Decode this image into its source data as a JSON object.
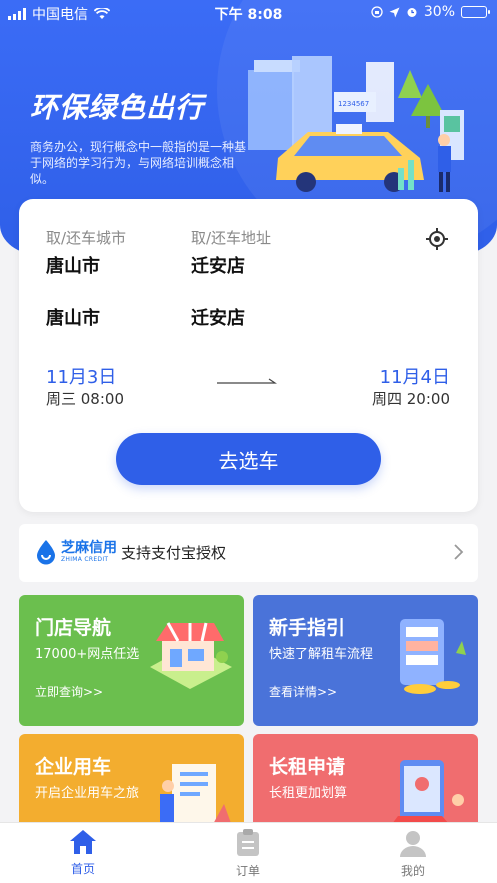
{
  "status_bar": {
    "carrier": "中国电信",
    "time": "下午 8:08",
    "battery": "30%",
    "battery_level": 0.3
  },
  "hero": {
    "slogan": "环保绿色出行",
    "description": "商务办公，现行概念中一般指的是一种基于网络的学习行为，与网络培训概念相似。",
    "illustration_icon": "city-taxi-illustration",
    "sign_text": "1234567"
  },
  "booking": {
    "pickup_city_label": "取/还车城市",
    "pickup_address_label": "取/还车地址",
    "pickup_city": "唐山市",
    "pickup_store": "迁安店",
    "return_city": "唐山市",
    "return_store": "迁安店",
    "pickup_date": "11月3日",
    "pickup_time": "周三 08:00",
    "return_date": "11月4日",
    "return_time": "周四 20:00",
    "select_car_label": "去选车"
  },
  "zhima": {
    "logo_cn": "芝麻信用",
    "logo_en": "ZHIMA CREDIT",
    "text": "支持支付宝授权"
  },
  "tiles": [
    {
      "title": "门店导航",
      "subtitle": "17000+网点任选",
      "link": "立即查询>>"
    },
    {
      "title": "新手指引",
      "subtitle": "快速了解租车流程",
      "link": "查看详情>>"
    },
    {
      "title": "企业用车",
      "subtitle": "开启企业用车之旅"
    },
    {
      "title": "长租申请",
      "subtitle": "长租更加划算"
    }
  ],
  "tabbar": [
    {
      "label": "首页",
      "active": true
    },
    {
      "label": "订单",
      "active": false
    },
    {
      "label": "我的",
      "active": false
    }
  ],
  "colors": {
    "primary": "#2f5fe8",
    "green": "#6bbf4e",
    "blue_tile": "#4a73d9",
    "orange": "#f3ad2f",
    "red": "#f06d6f"
  }
}
